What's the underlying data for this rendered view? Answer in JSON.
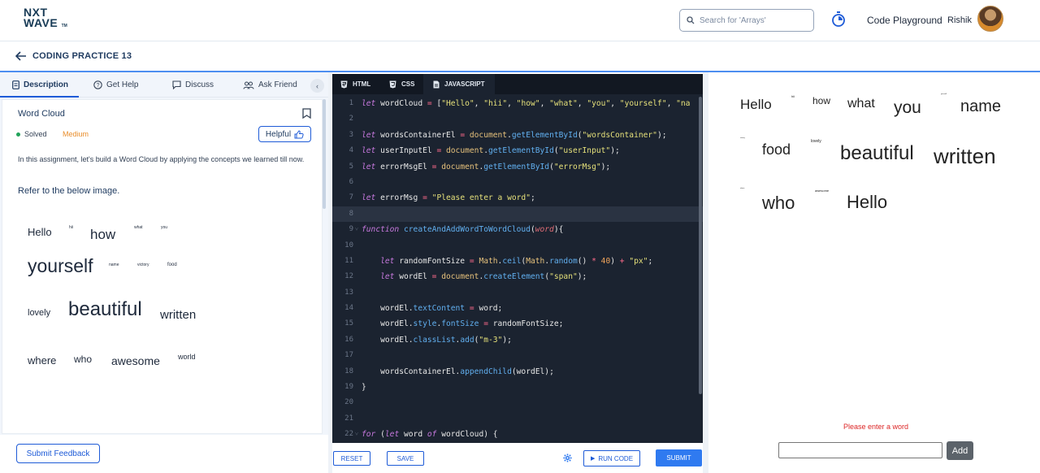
{
  "header": {
    "logo_line1": "NXT",
    "logo_line2": "WAVE",
    "logo_tm": "TM",
    "search_placeholder": "Search for 'Arrays'",
    "playground_label": "Code Playground",
    "username": "Rishik"
  },
  "breadcrumb": {
    "title": "CODING PRACTICE 13"
  },
  "left_tabs": [
    {
      "label": "Description",
      "icon": "document-icon"
    },
    {
      "label": "Get Help",
      "icon": "question-circle-icon"
    },
    {
      "label": "Discuss",
      "icon": "chat-icon"
    },
    {
      "label": "Ask Friend",
      "icon": "people-icon"
    }
  ],
  "question": {
    "title": "Word Cloud",
    "status": "Solved",
    "difficulty": "Medium",
    "helpful_label": "Helpful",
    "description": "In this assignment, let's build a Word Cloud by applying the concepts we learned till now.",
    "refer_text": "Refer to the below image.",
    "example_words": [
      "Hello",
      "hii",
      "how",
      "what",
      "you",
      "yourself",
      "name",
      "victory",
      "food",
      "lovely",
      "beautiful",
      "written",
      "where",
      "who",
      "awesome",
      "world"
    ]
  },
  "feedback_label": "Submit Feedback",
  "editor": {
    "tabs": [
      "HTML",
      "CSS",
      "JAVASCRIPT"
    ],
    "active_tab": "JAVASCRIPT",
    "lines": [
      "let wordCloud = [\"Hello\", \"hii\", \"how\", \"what\", \"you\", \"yourself\", \"na",
      "",
      "let wordsContainerEl = document.getElementById(\"wordsContainer\");",
      "let userInputEl = document.getElementById(\"userInput\");",
      "let errorMsgEl = document.getElementById(\"errorMsg\");",
      "",
      "let errorMsg = \"Please enter a word\";",
      "",
      "function createAndAddWordToWordCloud(word){",
      "",
      "    let randomFontSize = Math.ceil(Math.random() * 40) + \"px\";",
      "    let wordEl = document.createElement(\"span\");",
      "",
      "    wordEl.textContent = word;",
      "    wordEl.style.fontSize = randomFontSize;",
      "    wordEl.classList.add(\"m-3\");",
      "",
      "    wordsContainerEl.appendChild(wordEl);",
      "}",
      "",
      "",
      "for (let word of wordCloud) {"
    ],
    "reset_label": "RESET",
    "save_label": "SAVE",
    "run_label": "RUN CODE",
    "submit_label": "SUBMIT"
  },
  "preview": {
    "words": [
      "Hello",
      "hii",
      "how",
      "what",
      "you",
      "yourself",
      "name",
      "victory",
      "food",
      "lovely",
      "beautiful",
      "written",
      "where",
      "awesome",
      "who",
      "Hello"
    ],
    "error_message": "Please enter a word",
    "add_label": "Add"
  }
}
